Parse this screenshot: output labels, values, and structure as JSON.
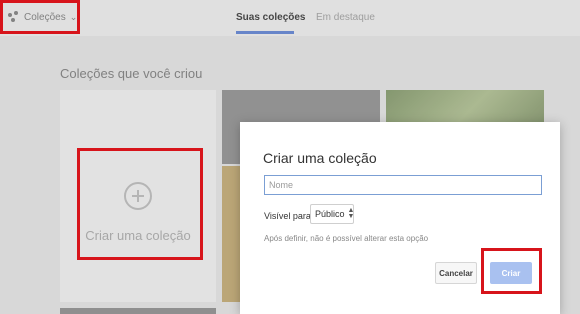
{
  "app": {
    "menu_label": "Coleções",
    "menu_icon": "collections-icon",
    "chevron_icon": "chevron-down-icon"
  },
  "tabs": [
    {
      "label": "Suas coleções",
      "active": true
    },
    {
      "label": "Em destaque",
      "active": false
    }
  ],
  "section": {
    "title": "Coleções que você criou",
    "create_card_label": "Criar uma coleção",
    "create_card_icon": "add-circle-icon"
  },
  "dialog": {
    "title": "Criar uma coleção",
    "name_value": "",
    "name_placeholder": "Nome",
    "visibility_label": "Visível para:",
    "visibility_value": "Público",
    "note": "Após definir, não é possível alterar esta opção",
    "cancel_label": "Cancelar",
    "create_label": "Criar"
  },
  "colors": {
    "accent": "#6e8fd8",
    "create_button": "#a9c1f0",
    "highlight": "#d7141b"
  }
}
